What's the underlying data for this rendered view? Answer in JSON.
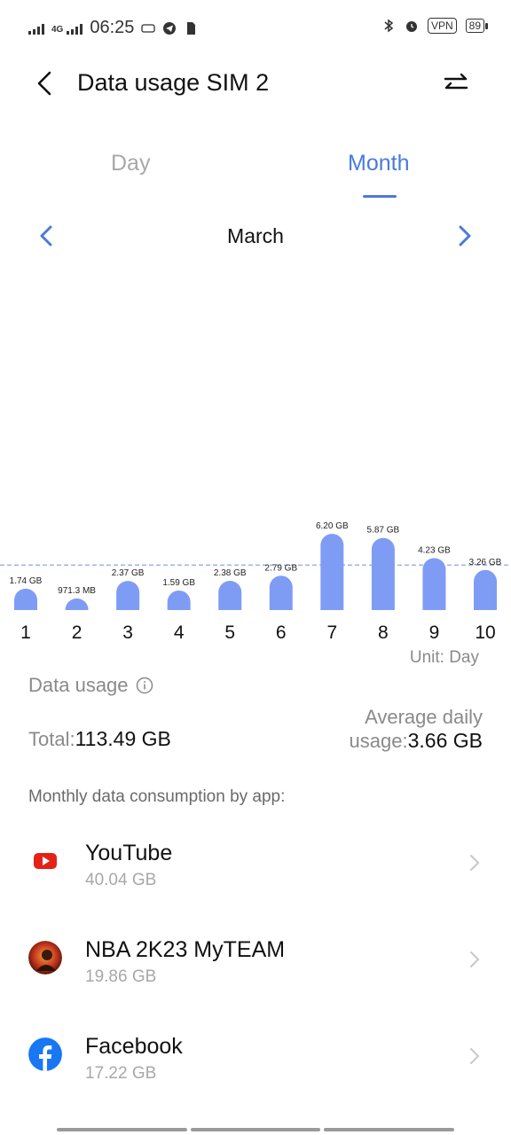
{
  "status_bar": {
    "network": "4G",
    "time": "06:25",
    "vpn": "VPN",
    "battery": "89"
  },
  "header": {
    "title": "Data usage SIM 2"
  },
  "tabs": [
    {
      "label": "Day",
      "active": false
    },
    {
      "label": "Month",
      "active": true
    }
  ],
  "month_nav": {
    "label": "March"
  },
  "chart_data": {
    "type": "bar",
    "categories": [
      "1",
      "2",
      "3",
      "4",
      "5",
      "6",
      "7",
      "8",
      "9",
      "10"
    ],
    "values_gb": [
      1.74,
      0.9485,
      2.37,
      1.59,
      2.38,
      2.79,
      6.2,
      5.87,
      4.23,
      3.26
    ],
    "data_labels": [
      "1.74 GB",
      "971.3 MB",
      "2.37 GB",
      "1.59 GB",
      "2.38 GB",
      "2.79 GB",
      "6.20 GB",
      "5.87 GB",
      "4.23 GB",
      "3.26 GB"
    ],
    "average_line_gb": 3.66,
    "unit_label": "Unit: Day",
    "bar_color": "#7f9cf5",
    "avg_line_color": "#8fa8e0"
  },
  "summary": {
    "label": "Data usage",
    "total_label": "Total:",
    "total_value": "113.49 GB",
    "avg_label_line1": "Average daily",
    "avg_label_line2": "usage:",
    "avg_value": "3.66 GB"
  },
  "monthly_label": "Monthly data consumption by app:",
  "apps": [
    {
      "name": "YouTube",
      "size": "40.04 GB",
      "icon": "youtube-icon"
    },
    {
      "name": "NBA 2K23 MyTEAM",
      "size": "19.86 GB",
      "icon": "nba-2k23-icon"
    },
    {
      "name": "Facebook",
      "size": "17.22 GB",
      "icon": "facebook-icon"
    }
  ],
  "colors": {
    "accent": "#4a7bd8",
    "muted": "#a8a8a8"
  }
}
